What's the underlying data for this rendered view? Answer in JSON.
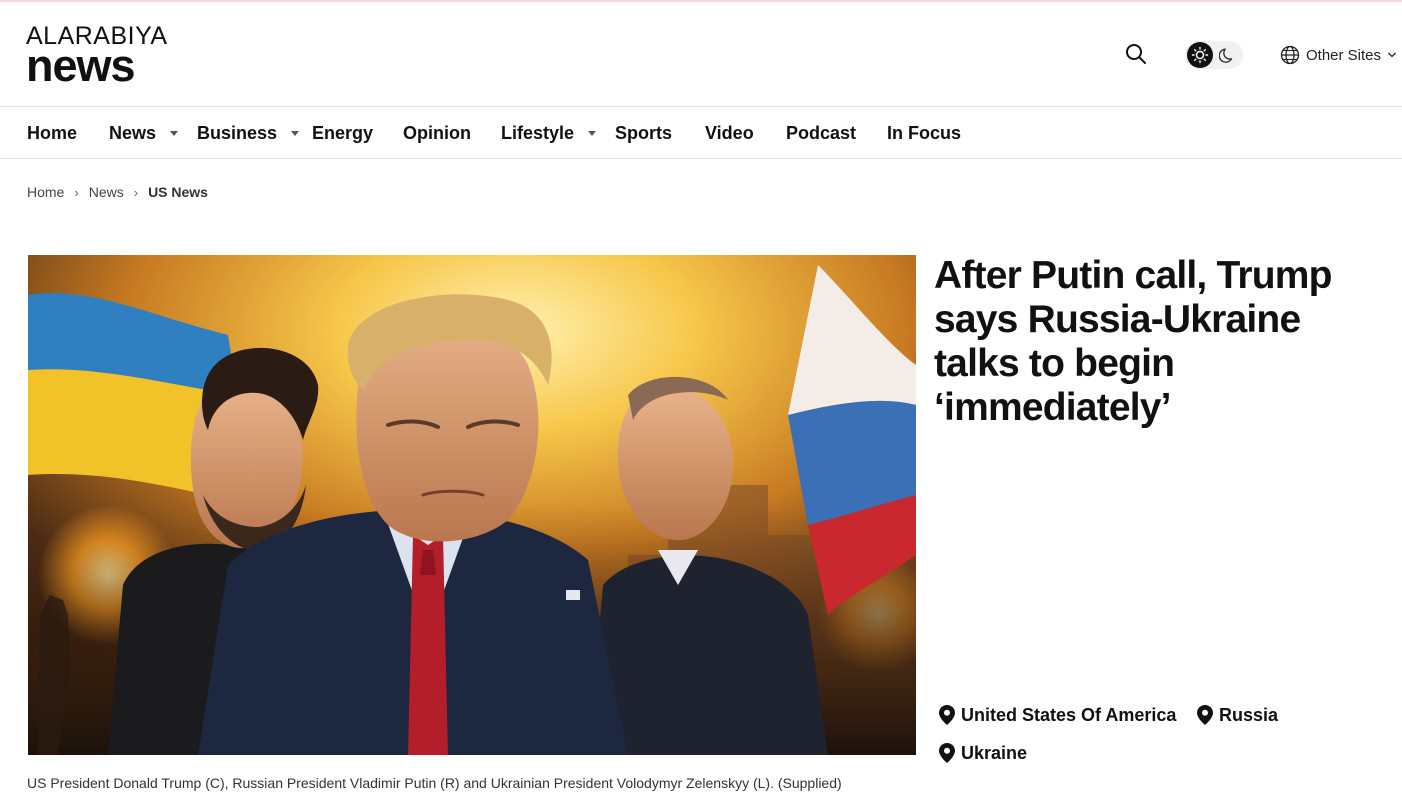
{
  "brand": {
    "logo_top": "ALARABIYA",
    "logo_bottom": "news"
  },
  "header": {
    "other_sites_label": "Other Sites"
  },
  "nav": {
    "items": [
      {
        "label": "Home",
        "has_dropdown": false
      },
      {
        "label": "News",
        "has_dropdown": true
      },
      {
        "label": "Business",
        "has_dropdown": true
      },
      {
        "label": "Energy",
        "has_dropdown": false
      },
      {
        "label": "Opinion",
        "has_dropdown": false
      },
      {
        "label": "Lifestyle",
        "has_dropdown": true
      },
      {
        "label": "Sports",
        "has_dropdown": false
      },
      {
        "label": "Video",
        "has_dropdown": false
      },
      {
        "label": "Podcast",
        "has_dropdown": false
      },
      {
        "label": "In Focus",
        "has_dropdown": false
      }
    ]
  },
  "breadcrumb": {
    "items": [
      "Home",
      "News",
      "US News"
    ]
  },
  "article": {
    "headline": "After Putin call, Trump says Russia-Ukraine talks to begin ‘immediately’",
    "caption": "US President Donald Trump (C), Russian President Vladimir Putin (R) and Ukrainian President Volodymyr Zelenskyy (L). (Supplied)",
    "tags": [
      "United States Of America",
      "Russia",
      "Ukraine"
    ]
  },
  "colors": {
    "accent": "#111111",
    "divider": "#e3e3e3",
    "top_line": "#f3d6dc"
  }
}
